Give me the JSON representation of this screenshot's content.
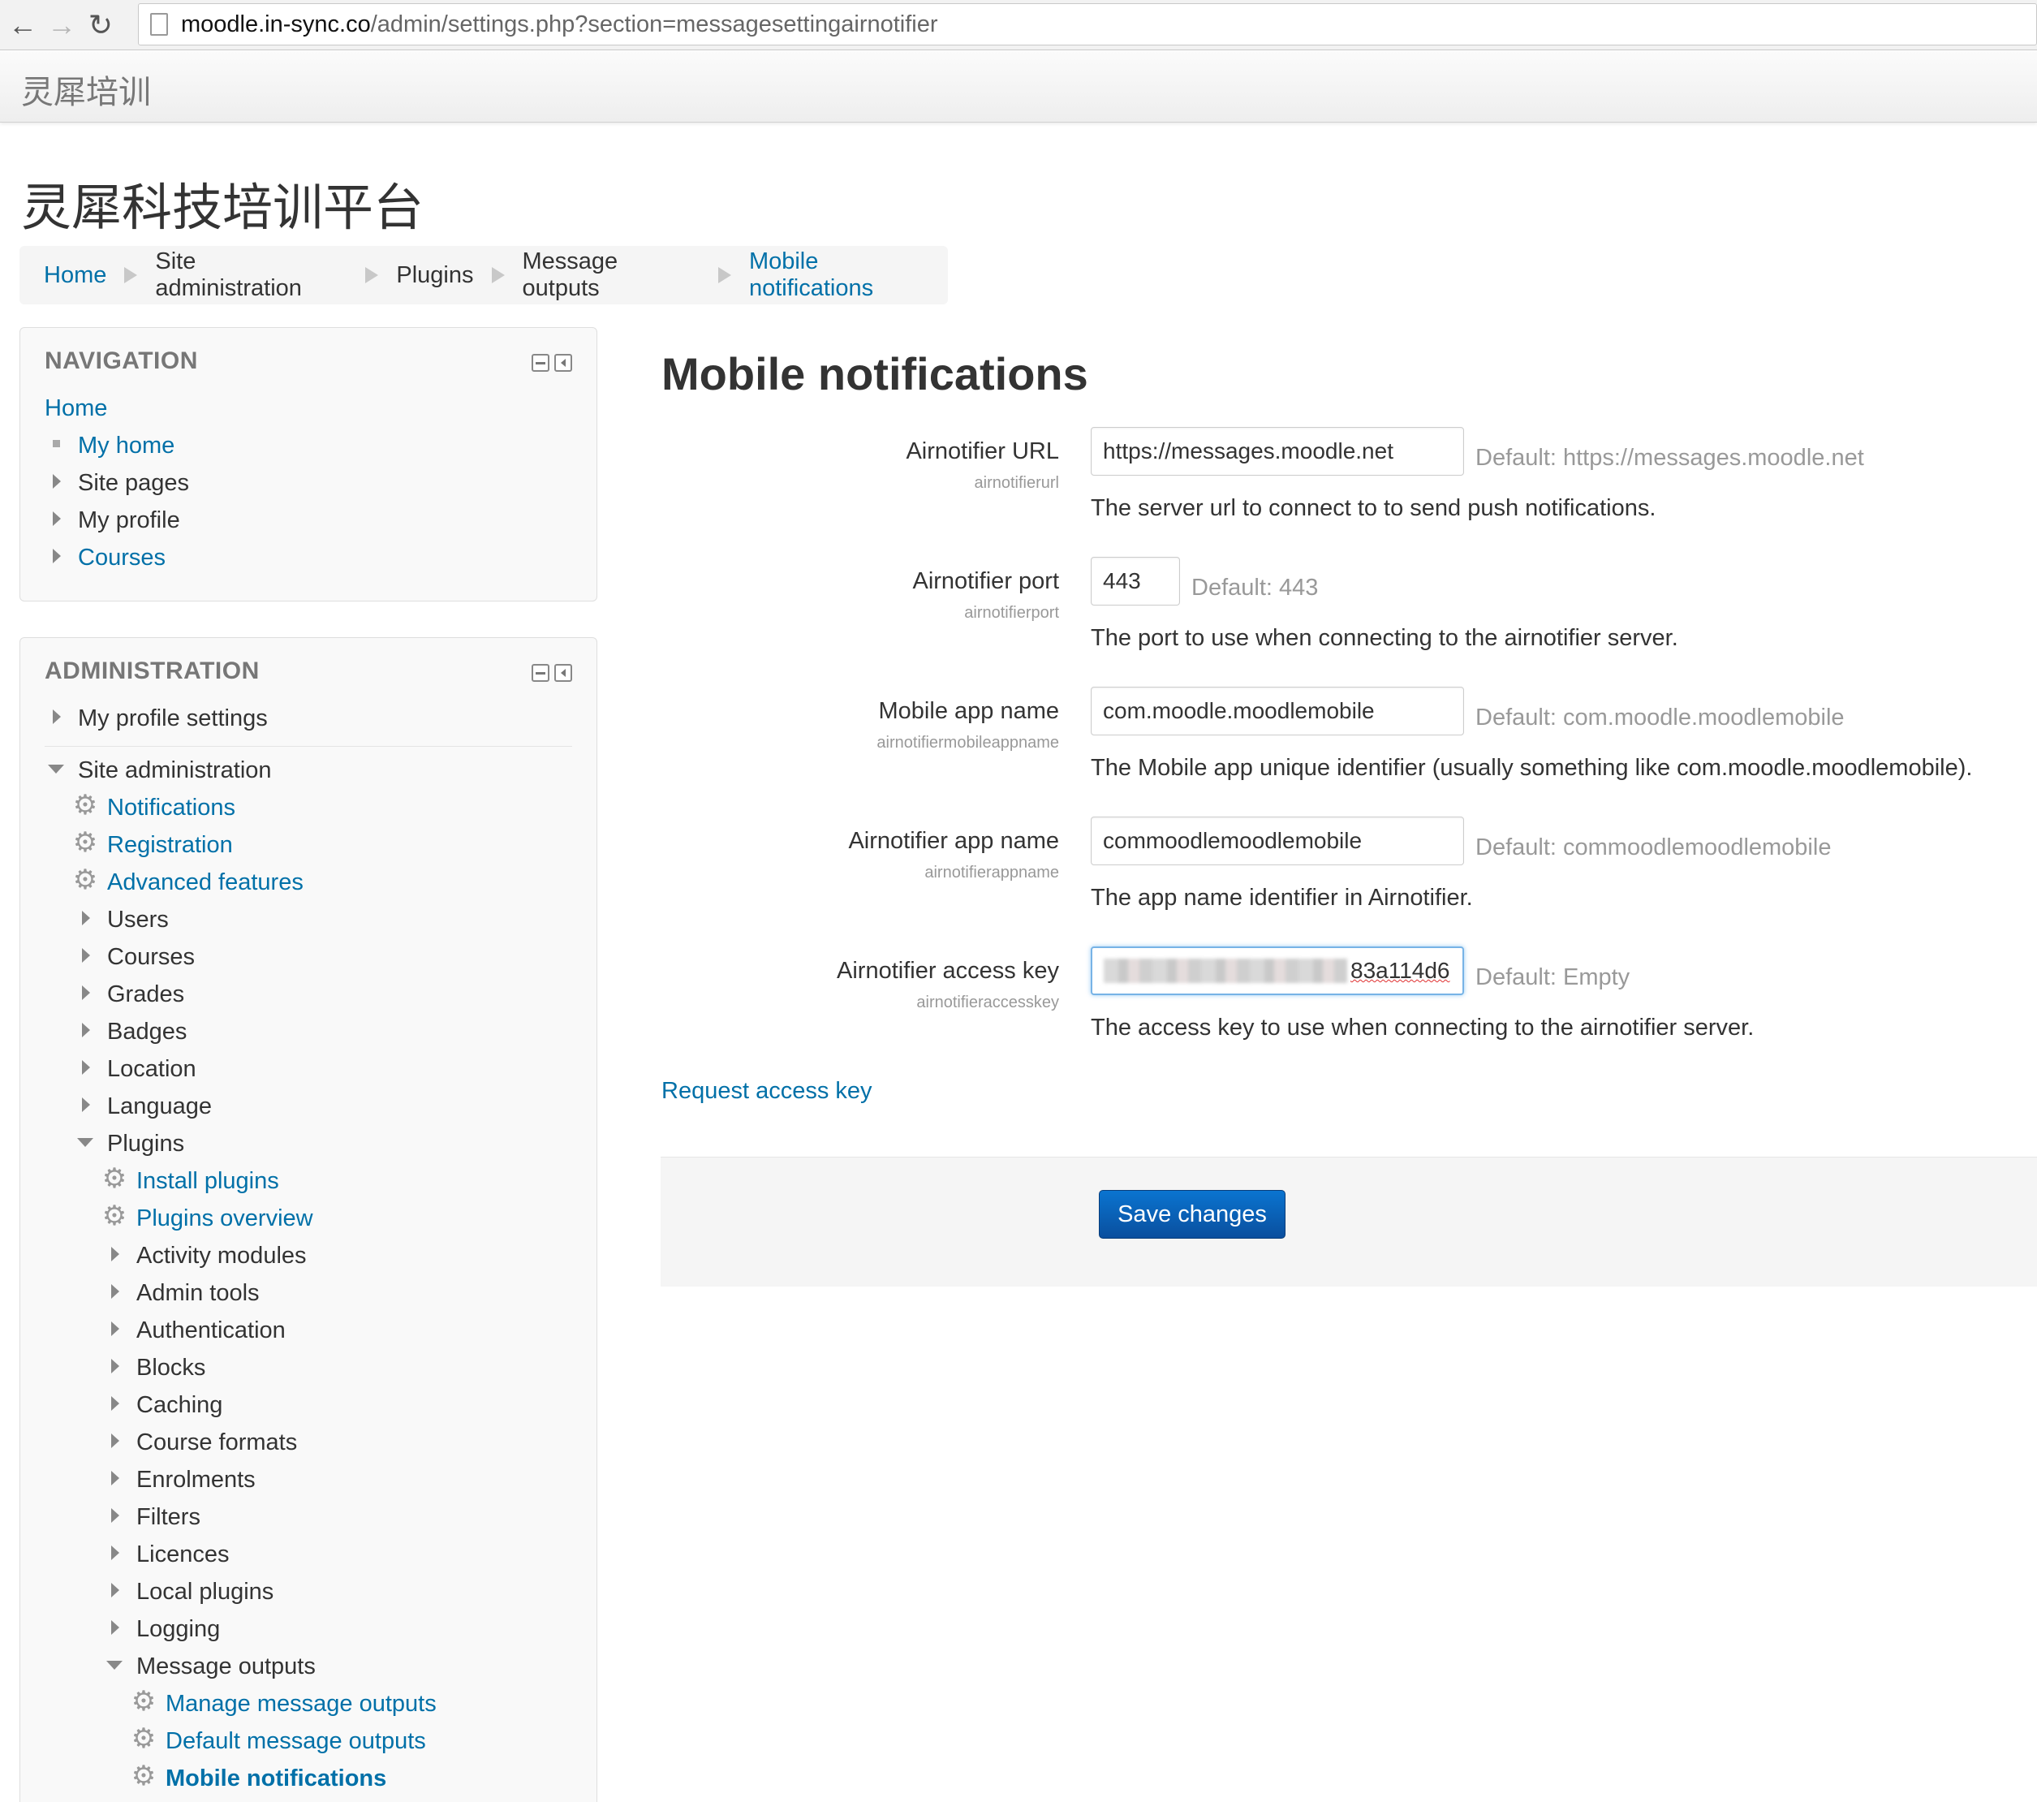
{
  "browser": {
    "url_host": "moodle.in-sync.co",
    "url_path": "/admin/settings.php?section=messagesettingairnotifier"
  },
  "site": {
    "brand": "灵犀培训",
    "heading": "灵犀科技培训平台"
  },
  "breadcrumb": [
    "Home",
    "Site administration",
    "Plugins",
    "Message outputs",
    "Mobile notifications"
  ],
  "navigation": {
    "title": "NAVIGATION",
    "items": [
      "Home",
      "My home",
      "Site pages",
      "My profile",
      "Courses"
    ]
  },
  "administration": {
    "title": "ADMINISTRATION",
    "my_profile_settings": "My profile settings",
    "site_administration": "Site administration",
    "notifications": "Notifications",
    "registration": "Registration",
    "advanced_features": "Advanced features",
    "users": "Users",
    "courses": "Courses",
    "grades": "Grades",
    "badges": "Badges",
    "location": "Location",
    "language": "Language",
    "plugins": "Plugins",
    "install_plugins": "Install plugins",
    "plugins_overview": "Plugins overview",
    "activity_modules": "Activity modules",
    "admin_tools": "Admin tools",
    "authentication": "Authentication",
    "blocks": "Blocks",
    "caching": "Caching",
    "course_formats": "Course formats",
    "enrolments": "Enrolments",
    "filters": "Filters",
    "licences": "Licences",
    "local_plugins": "Local plugins",
    "logging": "Logging",
    "message_outputs": "Message outputs",
    "manage_message_outputs": "Manage message outputs",
    "default_message_outputs": "Default message outputs",
    "mobile_notifications": "Mobile notifications"
  },
  "main": {
    "title": "Mobile notifications",
    "settings": [
      {
        "label": "Airnotifier URL",
        "key": "airnotifierurl",
        "value": "https://messages.moodle.net",
        "default": "Default: https://messages.moodle.net",
        "description": "The server url to connect to to send push notifications."
      },
      {
        "label": "Airnotifier port",
        "key": "airnotifierport",
        "value": "443",
        "default": "Default: 443",
        "description": "The port to use when connecting to the airnotifier server."
      },
      {
        "label": "Mobile app name",
        "key": "airnotifiermobileappname",
        "value": "com.moodle.moodlemobile",
        "default": "Default: com.moodle.moodlemobile",
        "description": "The Mobile app unique identifier (usually something like com.moodle.moodlemobile)."
      },
      {
        "label": "Airnotifier app name",
        "key": "airnotifierappname",
        "value": "commoodlemoodlemobile",
        "default": "Default: commoodlemoodlemobile",
        "description": "The app name identifier in Airnotifier."
      },
      {
        "label": "Airnotifier access key",
        "key": "airnotifieraccesskey",
        "value_visible_tail": "83a114d6",
        "default": "Default: Empty",
        "description": "The access key to use when connecting to the airnotifier server."
      }
    ],
    "request_access_key": "Request access key",
    "save_button": "Save changes"
  }
}
